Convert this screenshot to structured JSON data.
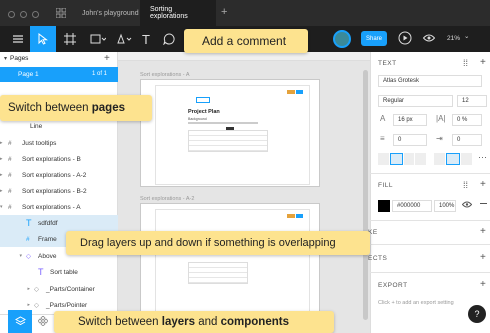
{
  "titlebar": {
    "tab_file": "John's playground",
    "tab_active": "Sorting explorations",
    "tab_add": "+"
  },
  "toolbar": {
    "share_label": "Share",
    "zoom": "21%",
    "zoom_caret": "⌄"
  },
  "left_panel": {
    "pages_header": "Pages",
    "add_page": "+",
    "page_name": "Page 1",
    "page_count": "1 of 1",
    "layers": [
      "Line",
      "Just tooltips",
      "Sort explorations - B",
      "Sort explorations - A-2",
      "Sort explorations - B-2",
      "Sort explorations - A",
      "sdfdfdf",
      "Frame",
      "Above",
      "Sort table",
      "_Parts/Container",
      "_Parts/Pointer"
    ]
  },
  "canvas": {
    "frame_a_label": "Sort explorations - A",
    "frame_a2_label": "Sort explorations - A-2",
    "doc_title": "Project Plan",
    "doc_subheading": "Background"
  },
  "right_panel": {
    "text_header": "TEXT",
    "font_family": "Atlas Grotesk",
    "font_weight": "Regular",
    "font_size": "12",
    "line_height": "16 px",
    "letter_spacing": "0 %",
    "paragraph_spacing": "0",
    "fill_header": "FILL",
    "fill_hex": "#000000",
    "fill_opacity": "100%",
    "stroke_header": "KE",
    "effects_header": "ECTS",
    "export_header": "EXPORT",
    "export_hint": "Click + to add an export setting",
    "add": "+"
  },
  "callouts": {
    "comment": "Add a comment",
    "pages_pre": "Switch between ",
    "pages_bold": "pages",
    "drag": "Drag layers up and down if something is overlapping",
    "components_pre": "Switch between ",
    "components_bold1": "layers",
    "components_mid": " and ",
    "components_bold2": "components"
  },
  "help": "?",
  "colors": {
    "accent": "#18a0fb",
    "callout": "#fde38f",
    "selection": "#daebf7"
  }
}
